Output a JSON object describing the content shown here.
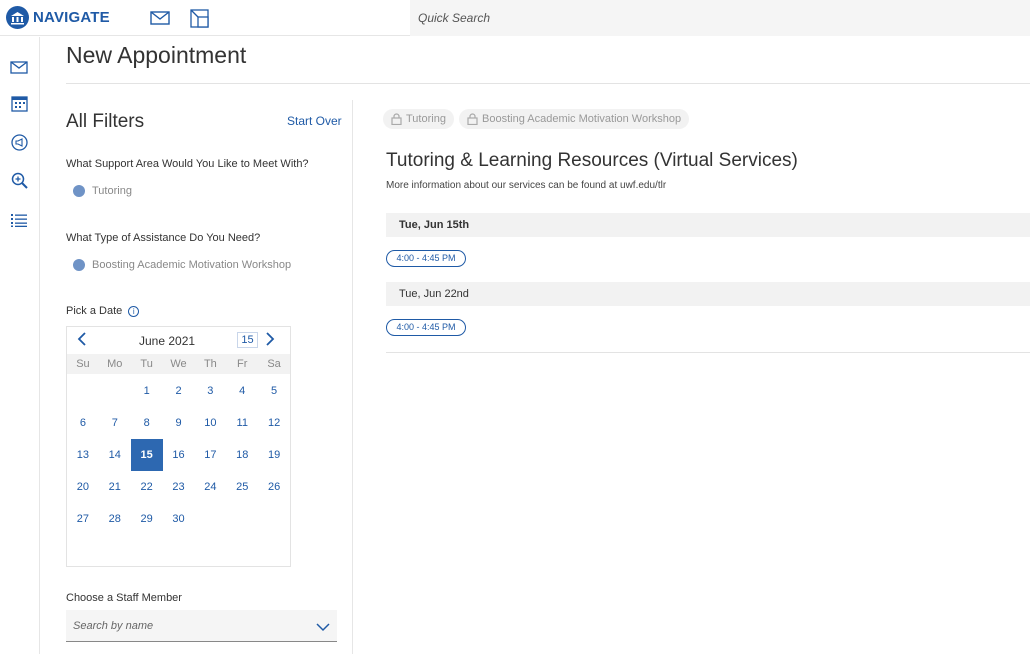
{
  "app": {
    "name": "NAVIGATE",
    "brand_color": "#1f5aa6",
    "top_icons": [
      "mail-icon",
      "split-window-icon"
    ],
    "search_placeholder": "Quick Search"
  },
  "rail": {
    "icons": [
      "mail-icon",
      "calendar-icon",
      "megaphone-icon",
      "zoom-in-icon",
      "list-icon"
    ]
  },
  "page": {
    "title": "New Appointment"
  },
  "filters": {
    "title": "All Filters",
    "start_over": "Start Over",
    "support_area": {
      "label": "What Support Area Would You Like to Meet With?",
      "value": "Tutoring"
    },
    "assistance": {
      "label": "What Type of Assistance Do You Need?",
      "value": "Boosting Academic Motivation Workshop"
    },
    "date": {
      "label": "Pick a Date",
      "info_icon": "info-icon"
    },
    "calendar": {
      "month": "June 2021",
      "today_button": "15",
      "weekdays": [
        "Su",
        "Mo",
        "Tu",
        "We",
        "Th",
        "Fr",
        "Sa"
      ],
      "weeks": [
        [
          "",
          "",
          "1",
          "2",
          "3",
          "4",
          "5"
        ],
        [
          "6",
          "7",
          "8",
          "9",
          "10",
          "11",
          "12"
        ],
        [
          "13",
          "14",
          "15",
          "16",
          "17",
          "18",
          "19"
        ],
        [
          "20",
          "21",
          "22",
          "23",
          "24",
          "25",
          "26"
        ],
        [
          "27",
          "28",
          "29",
          "30",
          "",
          "",
          ""
        ]
      ],
      "selected": "15"
    },
    "staff": {
      "label": "Choose a Staff Member",
      "placeholder": "Search by name"
    }
  },
  "results": {
    "pills": [
      "Tutoring",
      "Boosting Academic Motivation Workshop"
    ],
    "service_title": "Tutoring & Learning Resources (Virtual Services)",
    "service_info": "More information about our services can be found at uwf.edu/tlr",
    "days": [
      {
        "label": "Tue, Jun 15th",
        "slots": [
          "4:00 - 4:45 PM"
        ]
      },
      {
        "label": "Tue, Jun 22nd",
        "slots": [
          "4:00 - 4:45 PM"
        ]
      }
    ]
  }
}
